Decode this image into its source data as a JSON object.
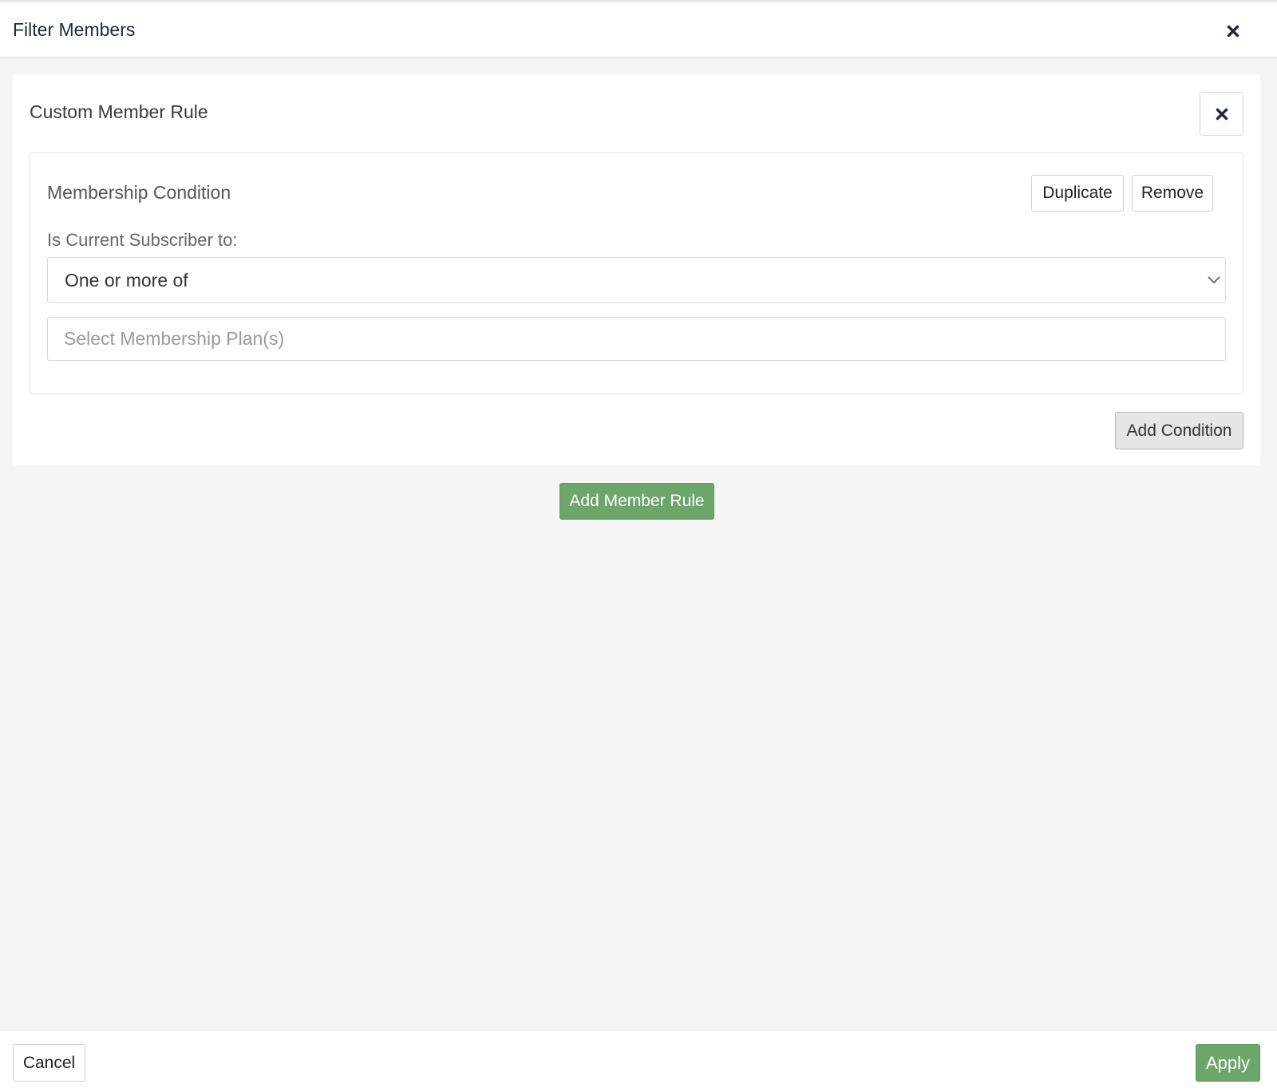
{
  "header": {
    "title": "Filter Members",
    "close_icon": "close-icon"
  },
  "rule": {
    "title": "Custom Member Rule",
    "close_icon": "close-icon",
    "condition": {
      "title": "Membership Condition",
      "duplicate_label": "Duplicate",
      "remove_label": "Remove",
      "field_label": "Is Current Subscriber to:",
      "match_select": {
        "selected": "One or more of",
        "icon": "chevron-down-icon"
      },
      "plans_input": {
        "value": "",
        "placeholder": "Select Membership Plan(s)"
      }
    },
    "add_condition_label": "Add Condition"
  },
  "add_rule_label": "Add Member Rule",
  "footer": {
    "cancel_label": "Cancel",
    "apply_label": "Apply"
  },
  "colors": {
    "primary_green": "#6da66a",
    "background": "#f5f5f5",
    "card": "#ffffff"
  }
}
